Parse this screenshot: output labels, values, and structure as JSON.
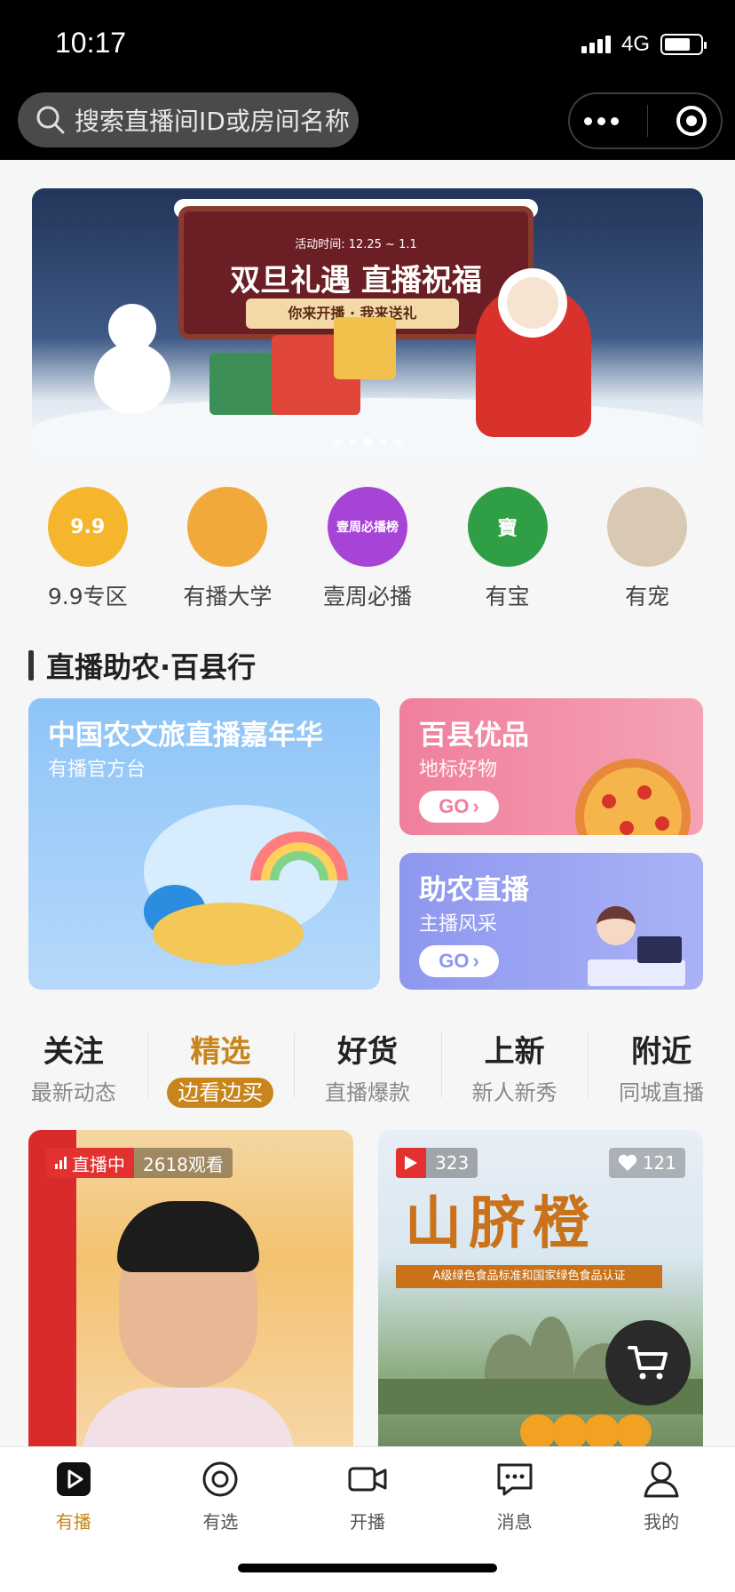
{
  "status_bar": {
    "time": "10:17",
    "network": "4G"
  },
  "search": {
    "placeholder": "搜索直播间ID或房间名称"
  },
  "banner": {
    "activity_time": "活动时间: 12.25 ~ 1.1",
    "title": "双旦礼遇 直播祝福",
    "subtitle": "你来开播 · 我来送礼",
    "page_count": 5,
    "active_page": 3
  },
  "categories": [
    {
      "label": "9.9专区",
      "icon": "gift-icon",
      "badge": "9.9",
      "color": "#f5b62e"
    },
    {
      "label": "有播大学",
      "icon": "graduation-cap-icon",
      "color": "#f0a93a"
    },
    {
      "label": "壹周必播",
      "icon": "weekly-rank-icon",
      "badge": "壹周必播榜",
      "color": "#a743d6"
    },
    {
      "label": "有宝",
      "icon": "treasure-icon",
      "badge": "寶",
      "color": "#2f9e44"
    },
    {
      "label": "有宠",
      "icon": "pet-dog-icon",
      "color": "#d9c8b3"
    }
  ],
  "section": {
    "title": "直播助农·百县行"
  },
  "promos": {
    "main": {
      "title": "中国农文旅直播嘉年华",
      "subtitle": "有播官方台"
    },
    "top_right": {
      "title": "百县优品",
      "subtitle": "地标好物",
      "cta": "GO"
    },
    "bottom_right": {
      "title": "助农直播",
      "subtitle": "主播风采",
      "cta": "GO"
    }
  },
  "tabs": [
    {
      "title": "关注",
      "subtitle": "最新动态",
      "active": false
    },
    {
      "title": "精选",
      "subtitle": "边看边买",
      "active": true
    },
    {
      "title": "好货",
      "subtitle": "直播爆款",
      "active": false
    },
    {
      "title": "上新",
      "subtitle": "新人新秀",
      "active": false
    },
    {
      "title": "附近",
      "subtitle": "同城直播",
      "active": false
    }
  ],
  "feed": [
    {
      "status": "直播中",
      "viewers": "2618观看"
    },
    {
      "plays": "323",
      "likes": "121",
      "poster_title": "山脐橙",
      "poster_strip": "A级绿色食品标准和国家绿色食品认证"
    }
  ],
  "bottom_nav": [
    {
      "label": "有播",
      "icon": "play-icon",
      "active": true
    },
    {
      "label": "有选",
      "icon": "select-icon",
      "active": false
    },
    {
      "label": "开播",
      "icon": "camera-icon",
      "active": false
    },
    {
      "label": "消息",
      "icon": "message-icon",
      "active": false
    },
    {
      "label": "我的",
      "icon": "profile-icon",
      "active": false
    }
  ],
  "colors": {
    "accent": "#c8851b",
    "live_red": "#e2312f"
  }
}
